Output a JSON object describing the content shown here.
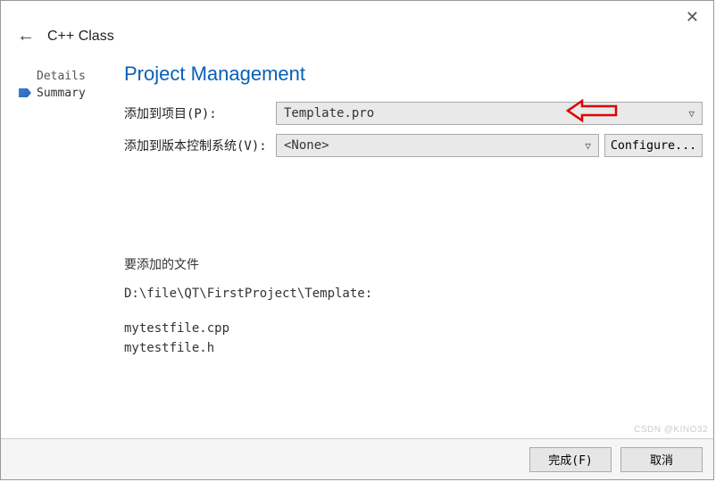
{
  "window": {
    "close_glyph": "✕",
    "back_glyph": "←",
    "wizard_title": "C++ Class"
  },
  "sidebar": {
    "items": [
      {
        "label": "Details",
        "active": false
      },
      {
        "label": "Summary",
        "active": true
      }
    ]
  },
  "page": {
    "title": "Project Management"
  },
  "form": {
    "project": {
      "label": "添加到项目(P):",
      "value": "Template.pro"
    },
    "vcs": {
      "label": "添加到版本控制系统(V):",
      "value": "<None>",
      "configure_label": "Configure..."
    }
  },
  "files": {
    "heading": "要添加的文件",
    "path": "D:\\file\\QT\\FirstProject\\Template:",
    "list": [
      "mytestfile.cpp",
      "mytestfile.h"
    ]
  },
  "footer": {
    "finish": "完成(F)",
    "cancel": "取消"
  },
  "watermark": "CSDN @KINO32"
}
